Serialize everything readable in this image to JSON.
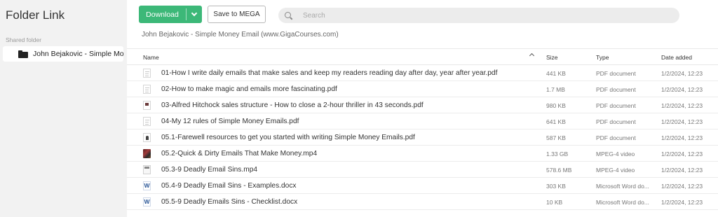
{
  "sidebar": {
    "title": "Folder Link",
    "section_label": "Shared folder",
    "folder_name": "John Bejakovic - Simple Money Email (www.GigaCourses.com)"
  },
  "toolbar": {
    "download_label": "Download",
    "save_label": "Save to MEGA",
    "search_placeholder": "Search"
  },
  "breadcrumb": "John Bejakovic - Simple Money Email (www.GigaCourses.com)",
  "table": {
    "headers": {
      "name": "Name",
      "size": "Size",
      "type": "Type",
      "date": "Date added"
    },
    "sort_direction": "ascending",
    "rows": [
      {
        "icon": "pdf-file-icon",
        "name": "01-How I write daily emails that make sales and keep my readers reading day after day, year after year.pdf",
        "size": "441 KB",
        "type": "PDF document",
        "date": "1/2/2024, 12:23"
      },
      {
        "icon": "pdf-file-icon",
        "name": "02-How to make magic and emails more fascinating.pdf",
        "size": "1.7 MB",
        "type": "PDF document",
        "date": "1/2/2024, 12:23"
      },
      {
        "icon": "pdf-thumbnail-icon",
        "name": "03-Alfred Hitchock sales structure - How to close a 2-hour thriller in 43 seconds.pdf",
        "size": "980 KB",
        "type": "PDF document",
        "date": "1/2/2024, 12:23"
      },
      {
        "icon": "pdf-file-icon",
        "name": "04-My 12 rules of Simple Money Emails.pdf",
        "size": "641 KB",
        "type": "PDF document",
        "date": "1/2/2024, 12:23"
      },
      {
        "icon": "pdf-thumbnail-icon",
        "name": "05.1-Farewell resources to get you started with writing Simple Money Emails.pdf",
        "size": "587 KB",
        "type": "PDF document",
        "date": "1/2/2024, 12:23"
      },
      {
        "icon": "video-thumbnail-icon",
        "name": "05.2-Quick & Dirty Emails That Make Money.mp4",
        "size": "1.33 GB",
        "type": "MPEG-4 video",
        "date": "1/2/2024, 12:23"
      },
      {
        "icon": "video-thumbnail-icon",
        "name": "05.3-9 Deadly Email Sins.mp4",
        "size": "578.6 MB",
        "type": "MPEG-4 video",
        "date": "1/2/2024, 12:23"
      },
      {
        "icon": "word-file-icon",
        "name": "05.4-9 Deadly Email Sins - Examples.docx",
        "size": "303 KB",
        "type": "Microsoft Word do...",
        "date": "1/2/2024, 12:23"
      },
      {
        "icon": "word-file-icon",
        "name": "05.5-9 Deadly Emails Sins - Checklist.docx",
        "size": "10 KB",
        "type": "Microsoft Word do...",
        "date": "1/2/2024, 12:23"
      }
    ]
  },
  "colors": {
    "accent": "#3cb878",
    "sidebar_bg": "#f2f2f2",
    "search_bg": "#ececec"
  }
}
